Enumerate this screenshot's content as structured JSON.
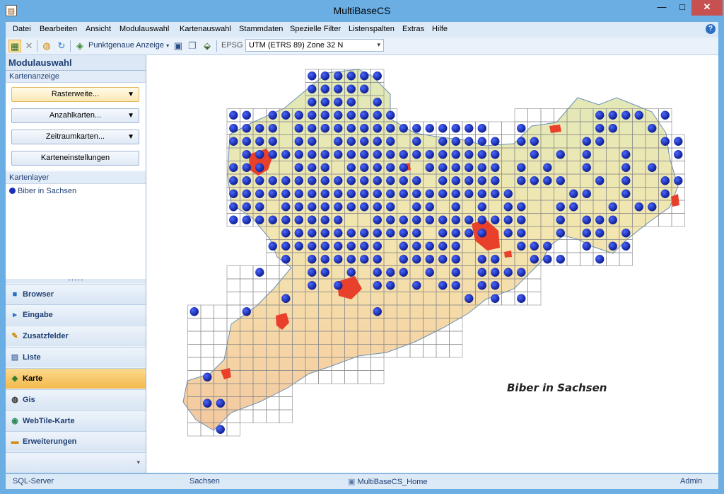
{
  "window": {
    "title": "MultiBaseCS",
    "minimize": "—",
    "maximize": "□",
    "close": "✕"
  },
  "menu": {
    "items": [
      "Datei",
      "Bearbeiten",
      "Ansicht",
      "Modulauswahl",
      "Kartenauswahl",
      "Stammdaten",
      "Spezielle Filter",
      "Listenspalten",
      "Extras",
      "Hilfe"
    ],
    "help_icon": "?"
  },
  "toolbar": {
    "precise_display_label": "Punktgenaue Anzeige",
    "epsg_label": "EPSG",
    "epsg_value": "UTM (ETRS 89) Zone 32 N",
    "icons": [
      "layers-icon",
      "delete-icon",
      "globe-icon",
      "refresh-icon",
      "map-view-icon",
      "save-icon",
      "copy-icon",
      "export-icon"
    ]
  },
  "sidebar": {
    "header": "Modulauswahl",
    "kartenanzeige_label": "Kartenanzeige",
    "buttons": [
      "Rasterweite...",
      "Anzahlkarten...",
      "Zeitraumkarten...",
      "Karteneinstellungen"
    ],
    "kartenlayer_label": "Kartenlayer",
    "layers": [
      "Biber in Sachsen"
    ]
  },
  "nav": {
    "items": [
      {
        "label": "Browser",
        "icon": "browser-icon",
        "active": false
      },
      {
        "label": "Eingabe",
        "icon": "input-icon",
        "active": false
      },
      {
        "label": "Zusatzfelder",
        "icon": "extra-fields-icon",
        "active": false
      },
      {
        "label": "Liste",
        "icon": "list-icon",
        "active": false
      },
      {
        "label": "Karte",
        "icon": "map-icon",
        "active": true
      },
      {
        "label": "Gis",
        "icon": "gis-icon",
        "active": false
      },
      {
        "label": "WebTile-Karte",
        "icon": "webtile-icon",
        "active": false
      },
      {
        "label": "Erweiterungen",
        "icon": "extensions-icon",
        "active": false
      }
    ]
  },
  "map": {
    "label": "Biber in Sachsen",
    "dot_color": "#1a2fb8",
    "city_color": "#e8402a"
  },
  "status": {
    "server": "SQL-Server",
    "region": "Sachsen",
    "database": "MultiBaseCS_Home",
    "user": "Admin"
  },
  "colors": {
    "accent": "#6aaee4",
    "nav_active": "#f3b94c"
  }
}
